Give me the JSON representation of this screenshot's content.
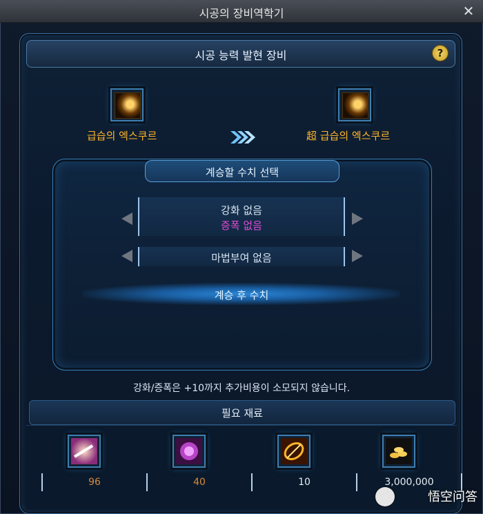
{
  "window": {
    "title": "시공의 장비역학기"
  },
  "panel": {
    "title": "시공 능력 발현 장비"
  },
  "equipment": {
    "source": {
      "name": "급습의 엑스쿠르"
    },
    "target": {
      "name": "超 급습의 엑스쿠르"
    }
  },
  "select": {
    "title": "계승할 수치 선택",
    "option1_line1": "강화 없음",
    "option1_line2": "증폭 없음",
    "option2": "마법부여 없음",
    "after_label": "계승 후 수치"
  },
  "notice": "강화/증폭은 +10까지 추가비용이 소모되지 않습니다.",
  "materials": {
    "header": "필요 재료",
    "items": [
      {
        "count": "96",
        "count_color": "#d98a3a"
      },
      {
        "count": "40",
        "count_color": "#d98a3a"
      },
      {
        "count": "10",
        "count_color": "#e7edf4"
      },
      {
        "count": "3,000,000",
        "count_color": "#e7edf4"
      }
    ]
  },
  "watermark": {
    "text": "悟空问答"
  },
  "colors": {
    "accent": "#3e7fb1",
    "item_name": "#ffb62a",
    "amp": "#e14bd6"
  }
}
